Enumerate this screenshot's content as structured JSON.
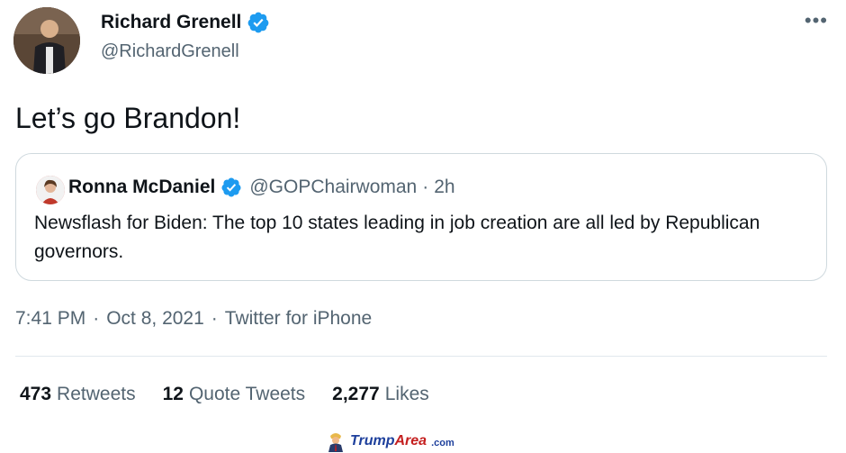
{
  "author": {
    "name": "Richard Grenell",
    "handle": "@RichardGrenell",
    "verified": true,
    "avatar_icon": "person-avatar"
  },
  "menu": {
    "more_label": "•••",
    "icon": "more-horizontal-icon"
  },
  "tweet": {
    "text": "Let’s go Brandon!"
  },
  "quoted": {
    "name": "Ronna McDaniel",
    "handle": "@GOPChairwoman",
    "separator": "·",
    "time": "2h",
    "text": "Newsflash for Biden: The top 10 states leading in job creation are all led by Republican governors."
  },
  "meta": {
    "time": "7:41 PM",
    "dot1": "·",
    "date": "Oct 8, 2021",
    "dot2": "·",
    "source": "Twitter for iPhone"
  },
  "stats": {
    "retweets_count": "473",
    "retweets_label": "Retweets",
    "quotes_count": "12",
    "quotes_label": "Quote Tweets",
    "likes_count": "2,277",
    "likes_label": "Likes"
  },
  "watermark": {
    "brand_main": "Trump",
    "brand_accent": "Area",
    "suffix": ".com"
  },
  "colors": {
    "verified_blue": "#1d9bf0",
    "text_primary": "#0f1419",
    "text_secondary": "#536471",
    "border": "#cfd9de"
  }
}
